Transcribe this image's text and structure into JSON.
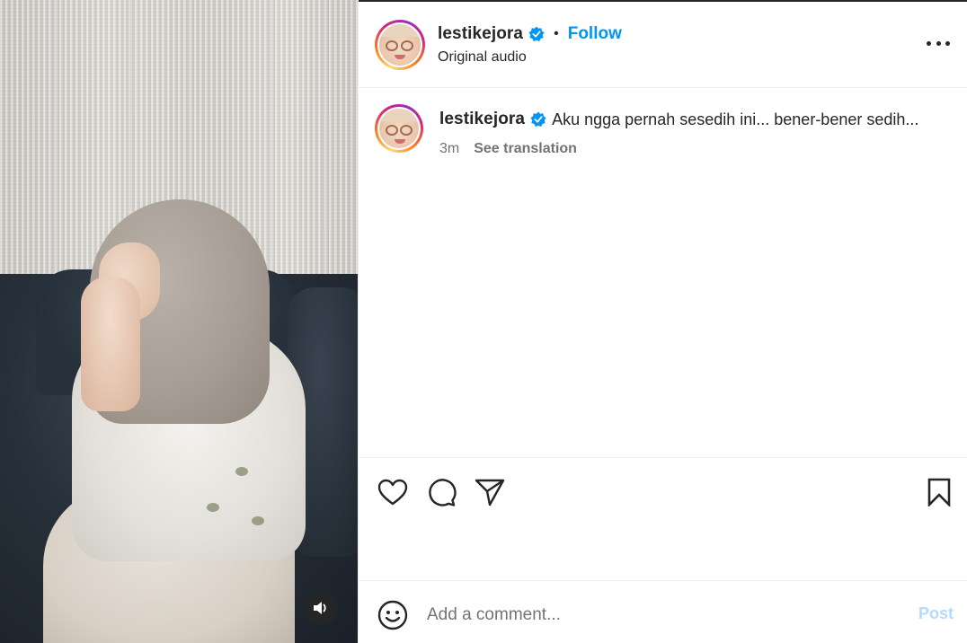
{
  "post": {
    "author": {
      "username": "lestikejora",
      "verified": true
    },
    "header": {
      "follow_label": "Follow",
      "separator": "•",
      "audio_label": "Original audio"
    },
    "caption": {
      "text": "Aku ngga pernah sesedih ini... bener-bener sedih...",
      "time": "3m",
      "translate_label": "See translation"
    },
    "icons": {
      "more": "more-options-icon",
      "like": "heart-icon",
      "comment": "comment-icon",
      "share": "send-icon",
      "save": "bookmark-icon",
      "emoji": "emoji-icon",
      "volume": "speaker-icon"
    },
    "comment_box": {
      "placeholder": "Add a comment...",
      "post_label": "Post"
    },
    "colors": {
      "accent": "#0095f6",
      "post_disabled": "#b3dbff",
      "verified": "#0095f6"
    }
  }
}
